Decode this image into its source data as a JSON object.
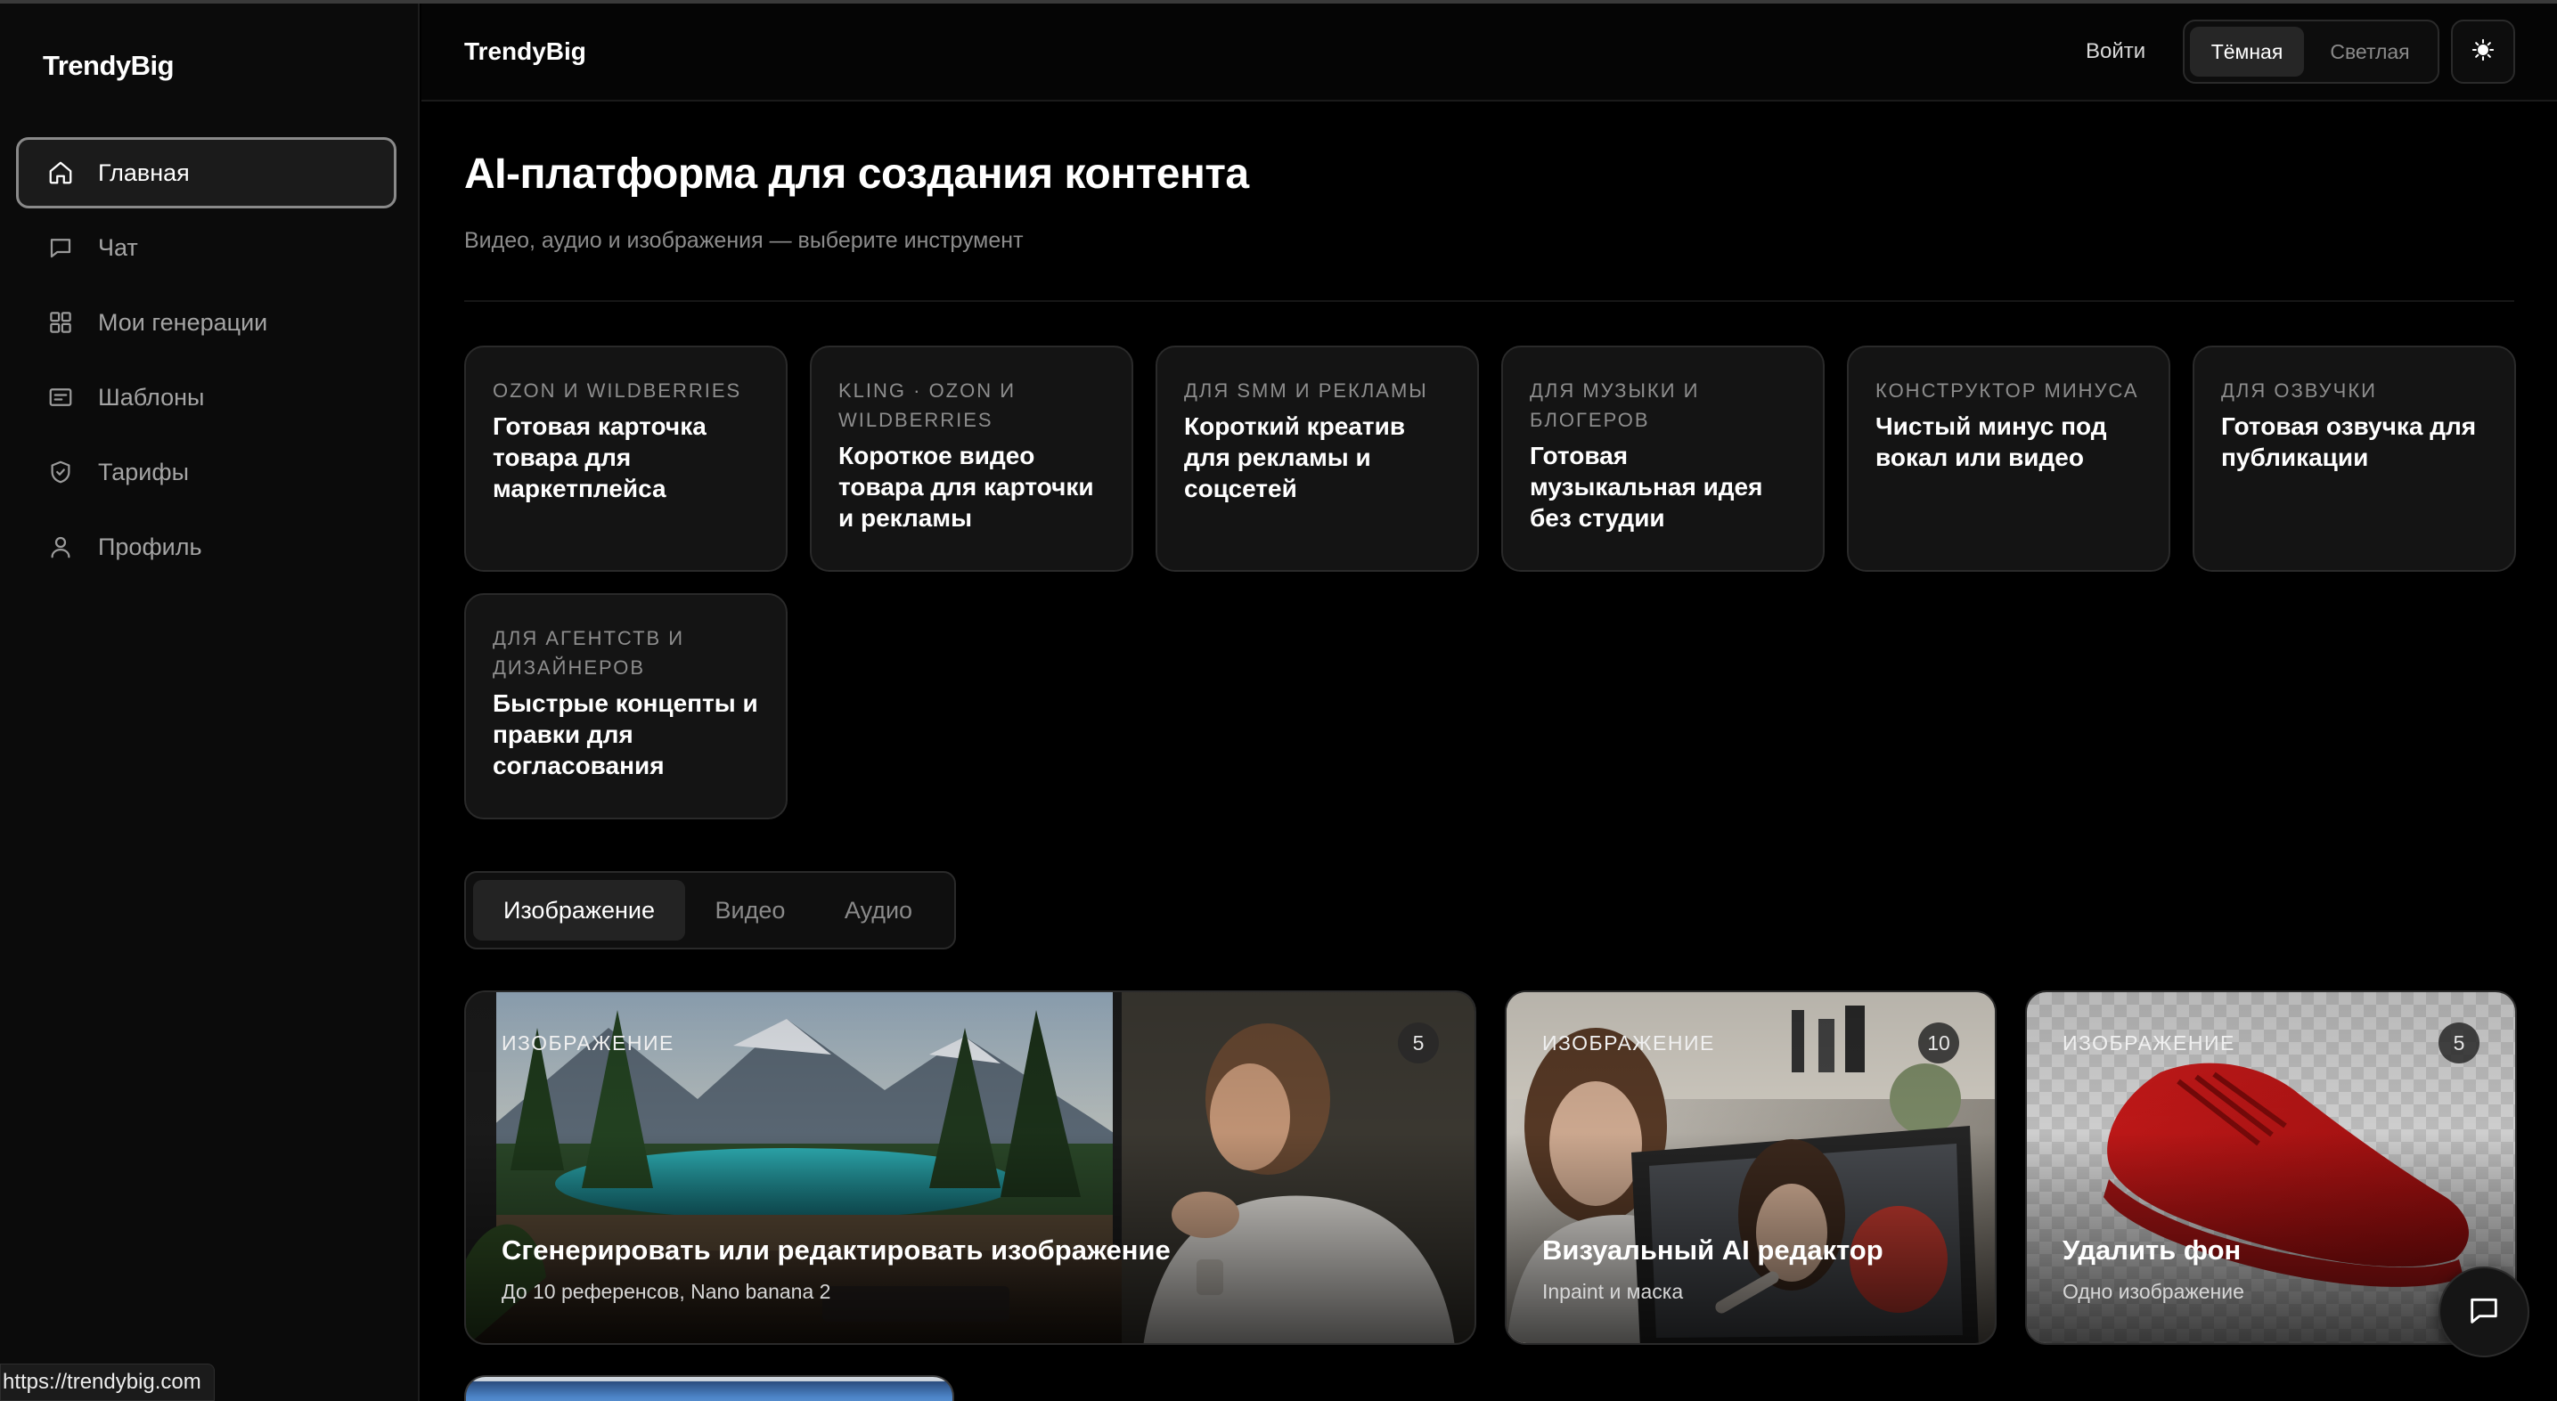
{
  "sidebar": {
    "logo": "TrendyBig",
    "items": [
      {
        "label": "Главная",
        "icon": "home-icon",
        "active": true
      },
      {
        "label": "Чат",
        "icon": "chat-icon"
      },
      {
        "label": "Мои генерации",
        "icon": "grid-icon"
      },
      {
        "label": "Шаблоны",
        "icon": "template-icon"
      },
      {
        "label": "Тарифы",
        "icon": "shield-icon"
      },
      {
        "label": "Профиль",
        "icon": "user-icon"
      }
    ]
  },
  "header": {
    "brand": "TrendyBig",
    "login": "Войти",
    "theme_dark": "Тёмная",
    "theme_light": "Светлая",
    "theme_icon": "sun-icon"
  },
  "main": {
    "title": "AI-платформа для создания контента",
    "subtitle": "Видео, аудио и изображения — выберите инструмент",
    "use_cases": [
      {
        "category": "OZON И WILDBERRIES",
        "title": "Готовая карточка товара для маркетплейса"
      },
      {
        "category": "KLING · OZON И WILDBERRIES",
        "title": "Короткое видео товара для карточки и рекламы"
      },
      {
        "category": "ДЛЯ SMM И РЕКЛАМЫ",
        "title": "Короткий креатив для рекламы и соцсетей"
      },
      {
        "category": "ДЛЯ МУЗЫКИ И БЛОГЕРОВ",
        "title": "Готовая музыкальная идея без студии"
      },
      {
        "category": "КОНСТРУКТОР МИНУСА",
        "title": "Чистый минус под вокал или видео"
      },
      {
        "category": "ДЛЯ ОЗВУЧКИ",
        "title": "Готовая озвучка для публикации"
      },
      {
        "category": "ДЛЯ АГЕНТСТВ И ДИЗАЙНЕРОВ",
        "title": "Быстрые концепты и правки для согласования"
      }
    ],
    "tabs": [
      {
        "label": "Изображение",
        "active": true
      },
      {
        "label": "Видео"
      },
      {
        "label": "Аудио"
      }
    ],
    "tools": [
      {
        "category": "ИЗОБРАЖЕНИЕ",
        "count": "5",
        "title": "Сгенерировать или редактировать изображение",
        "description": "До 10 референсов, Nano banana 2"
      },
      {
        "category": "ИЗОБРАЖЕНИЕ",
        "count": "10",
        "title": "Визуальный AI редактор",
        "description": "Inpaint и маска"
      },
      {
        "category": "ИЗОБРАЖЕНИЕ",
        "count": "5",
        "title": "Удалить фон",
        "description": "Одно изображение"
      }
    ]
  },
  "chat_fab_icon": "message-icon",
  "status_url": "https://trendybig.com"
}
